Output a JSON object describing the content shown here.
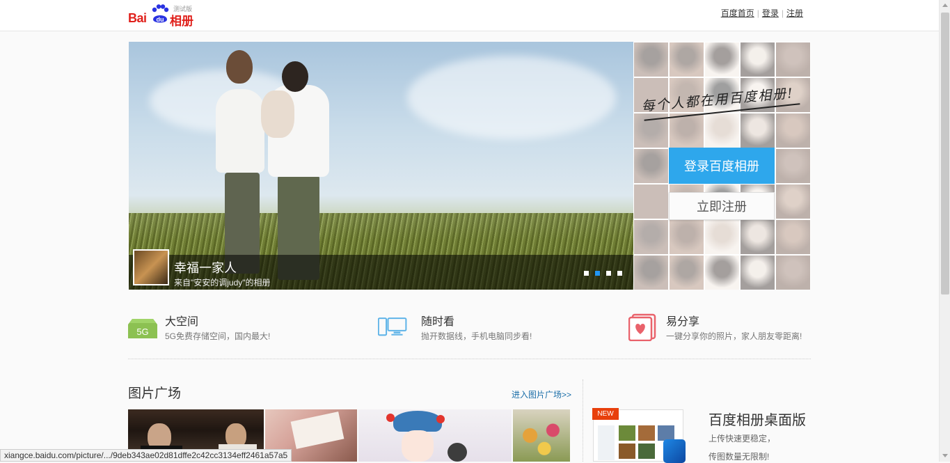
{
  "header": {
    "logo_text": "Bai",
    "logo_du": "du",
    "logo_product": "相册",
    "logo_badge": "测试版",
    "nav": [
      "百度首页",
      "登录",
      "注册"
    ]
  },
  "banner": {
    "caption_title": "幸福一家人",
    "caption_source": "来自\"安安的调judy\"的相册",
    "slides": 4,
    "active_slide": 2
  },
  "side": {
    "slogan": "每个人都在用百度相册!",
    "login_button": "登录百度相册",
    "register_button": "立即注册"
  },
  "features": [
    {
      "icon": "storage-5g-icon",
      "icon_text": "5G",
      "title": "大空间",
      "desc": "5G免费存储空间，国内最大!"
    },
    {
      "icon": "devices-icon",
      "title": "随时看",
      "desc": "抛开数据线，手机电脑同步看!"
    },
    {
      "icon": "share-heart-icon",
      "title": "易分享",
      "desc": "一键分享你的照片，家人朋友零距离!"
    }
  ],
  "square": {
    "title": "图片广场",
    "more_link": "进入图片广场>>"
  },
  "promo": {
    "badge": "NEW",
    "title": "百度相册桌面版",
    "line1": "上传快速更稳定，",
    "line2": "传图数量无限制!"
  },
  "statusbar": {
    "url": "xiangce.baidu.com/picture/.../9deb343ae02d81dffe2c42cc3134eff2461a57a5"
  },
  "colors": {
    "brand_red": "#e0201b",
    "brand_blue": "#2932e1",
    "login_blue": "#2ea7ec",
    "link_blue": "#1a6ea8"
  }
}
